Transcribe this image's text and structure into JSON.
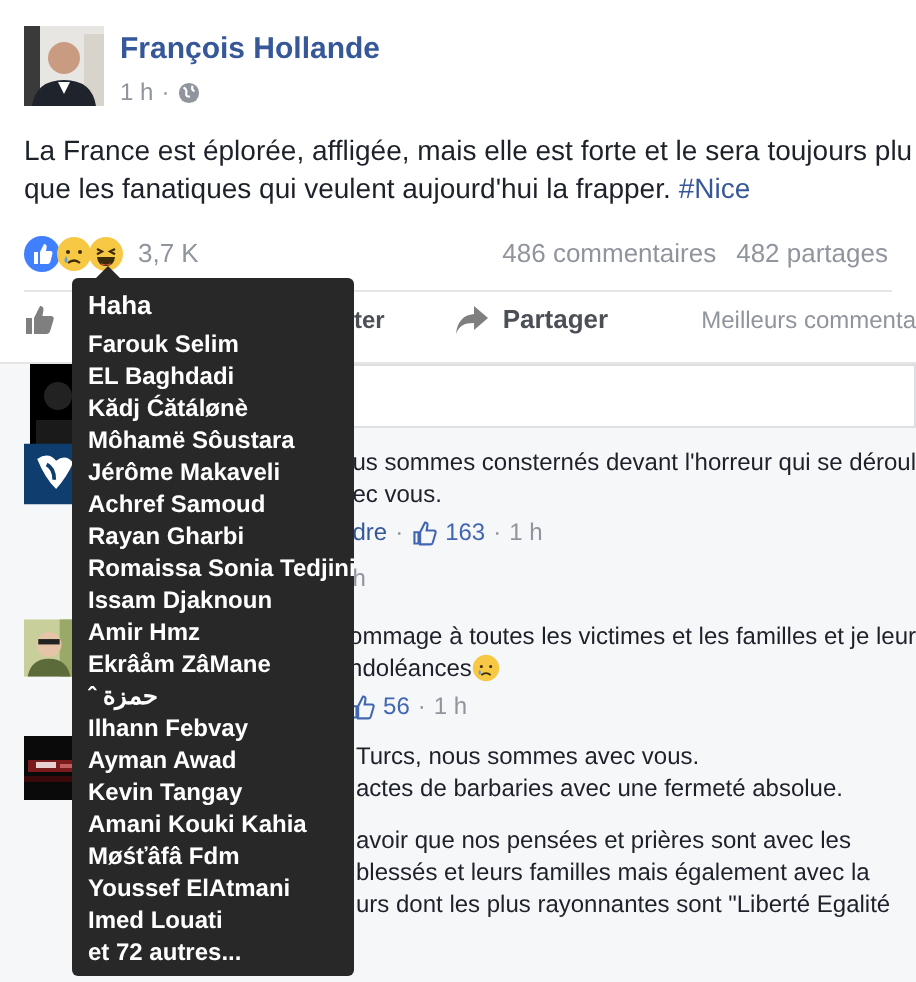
{
  "post": {
    "author": "François Hollande",
    "time": "1 h",
    "separator": "·",
    "text_lines": [
      "La France est éplorée, affligée, mais elle est forte et le sera toujours plu",
      "que les fanatiques qui veulent aujourd'hui la frapper."
    ],
    "hashtag": "#Nice",
    "reaction_count": "3,7 K",
    "comments_count": "486 commentaires",
    "shares_count": "482 partages"
  },
  "actions": {
    "comment_fragment": "ter",
    "share": "Partager",
    "sort": "Meilleurs commenta"
  },
  "tooltip": {
    "title": "Haha",
    "names": [
      "Farouk Selim",
      "EL Baghdadi",
      "Kădj Ćătálønè",
      "Môhamë Sôustara",
      "Jérôme Makaveli",
      "Achref Samoud",
      "Rayan Gharbi",
      "Romaissa Sonia Tedjini",
      "Issam Djaknoun",
      "Amir Hmz",
      "Ekrâåm ZâMane",
      "ˆ حمزة",
      "Ilhann Febvay",
      "Ayman Awad",
      "Kevin Tangay",
      "Amani Kouki Kahia",
      "Møśťâfâ Fdm",
      "Youssef ElAtmani",
      "Imed Louati",
      "et 72 autres..."
    ]
  },
  "comments": [
    {
      "lines": [
        "us sommes consternés devant l'horreur qui se déroul",
        "ec vous."
      ],
      "meta": [
        {
          "kind": "link",
          "text": "dre"
        },
        {
          "kind": "text",
          "text": "·"
        },
        {
          "kind": "like",
          "text": "163"
        },
        {
          "kind": "text",
          "text": "·"
        },
        {
          "kind": "text",
          "text": "1 h"
        }
      ],
      "replies": "h"
    },
    {
      "lines": [
        "ommage à toutes les victimes et les familles et je leur",
        "ndoléances"
      ],
      "emoji": true,
      "meta": [
        {
          "kind": "like",
          "text": "56"
        },
        {
          "kind": "text",
          "text": "·"
        },
        {
          "kind": "text",
          "text": "1 h"
        }
      ]
    },
    {
      "lines": [
        "Turcs, nous sommes avec vous.",
        "actes de barbaries avec une fermeté absolue."
      ],
      "paragraph": [
        "avoir que nos pensées et prières sont avec les",
        "blessés et leurs familles mais également avec la",
        "urs dont les plus rayonnantes sont \"Liberté Egalité"
      ]
    }
  ]
}
